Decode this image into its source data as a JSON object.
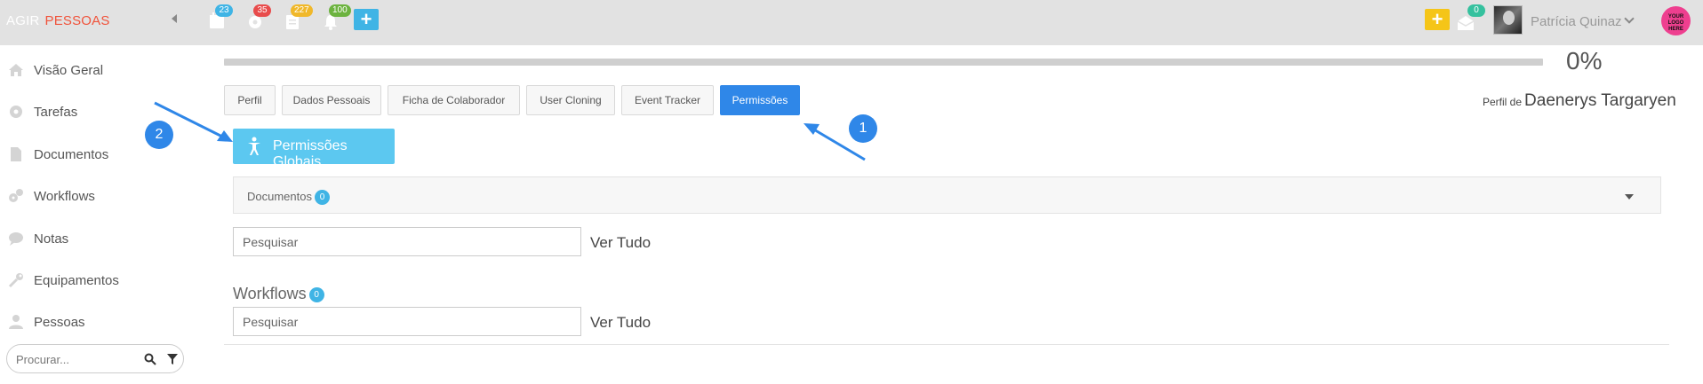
{
  "header": {
    "brand_part1": "AGIR",
    "brand_part2": "PESSOAS",
    "icons": [
      {
        "name": "calendar-icon",
        "badge": "23",
        "badge_color": "#3fb4e5"
      },
      {
        "name": "gear-icon",
        "badge": "35",
        "badge_color": "#e84c4c"
      },
      {
        "name": "clipboard-icon",
        "badge": "227",
        "badge_color": "#f0b82a"
      },
      {
        "name": "bell-icon",
        "badge": "100",
        "badge_color": "#6cb33f"
      }
    ],
    "add_button_color": "#3fb4e5",
    "quick_add_color": "#f5c518",
    "inbox_badge": "0",
    "inbox_badge_color": "#35c19e",
    "user_name": "Patrícia Quinaz",
    "logo_text": "YOUR LOGO HERE"
  },
  "sidebar": {
    "items": [
      {
        "label": "Visão Geral",
        "icon": "home-icon"
      },
      {
        "label": "Tarefas",
        "icon": "gear-icon"
      },
      {
        "label": "Documentos",
        "icon": "document-icon"
      },
      {
        "label": "Workflows",
        "icon": "cogs-icon"
      },
      {
        "label": "Notas",
        "icon": "comments-icon"
      },
      {
        "label": "Equipamentos",
        "icon": "wrench-icon"
      },
      {
        "label": "Pessoas",
        "icon": "user-icon"
      }
    ],
    "search_placeholder": "Procurar..."
  },
  "main": {
    "progress_value": 0,
    "progress_label": "0%",
    "profile_prefix": "Perfil de",
    "profile_name": "Daenerys Targaryen",
    "tabs": [
      {
        "label": "Perfil",
        "active": false
      },
      {
        "label": "Dados Pessoais",
        "active": false
      },
      {
        "label": "Ficha de Colaborador",
        "active": false
      },
      {
        "label": "User Cloning",
        "active": false
      },
      {
        "label": "Event Tracker",
        "active": false
      },
      {
        "label": "Permissões",
        "active": true
      }
    ],
    "global_permissions_label": "Permissões Globais",
    "documents": {
      "label": "Documentos",
      "count": "0",
      "search_placeholder": "Pesquisar",
      "view_all": "Ver Tudo"
    },
    "workflows": {
      "label": "Workflows",
      "count": "0",
      "search_placeholder": "Pesquisar",
      "view_all": "Ver Tudo"
    }
  },
  "annotations": {
    "marker_1": "1",
    "marker_2": "2",
    "color": "#2f87e8"
  }
}
